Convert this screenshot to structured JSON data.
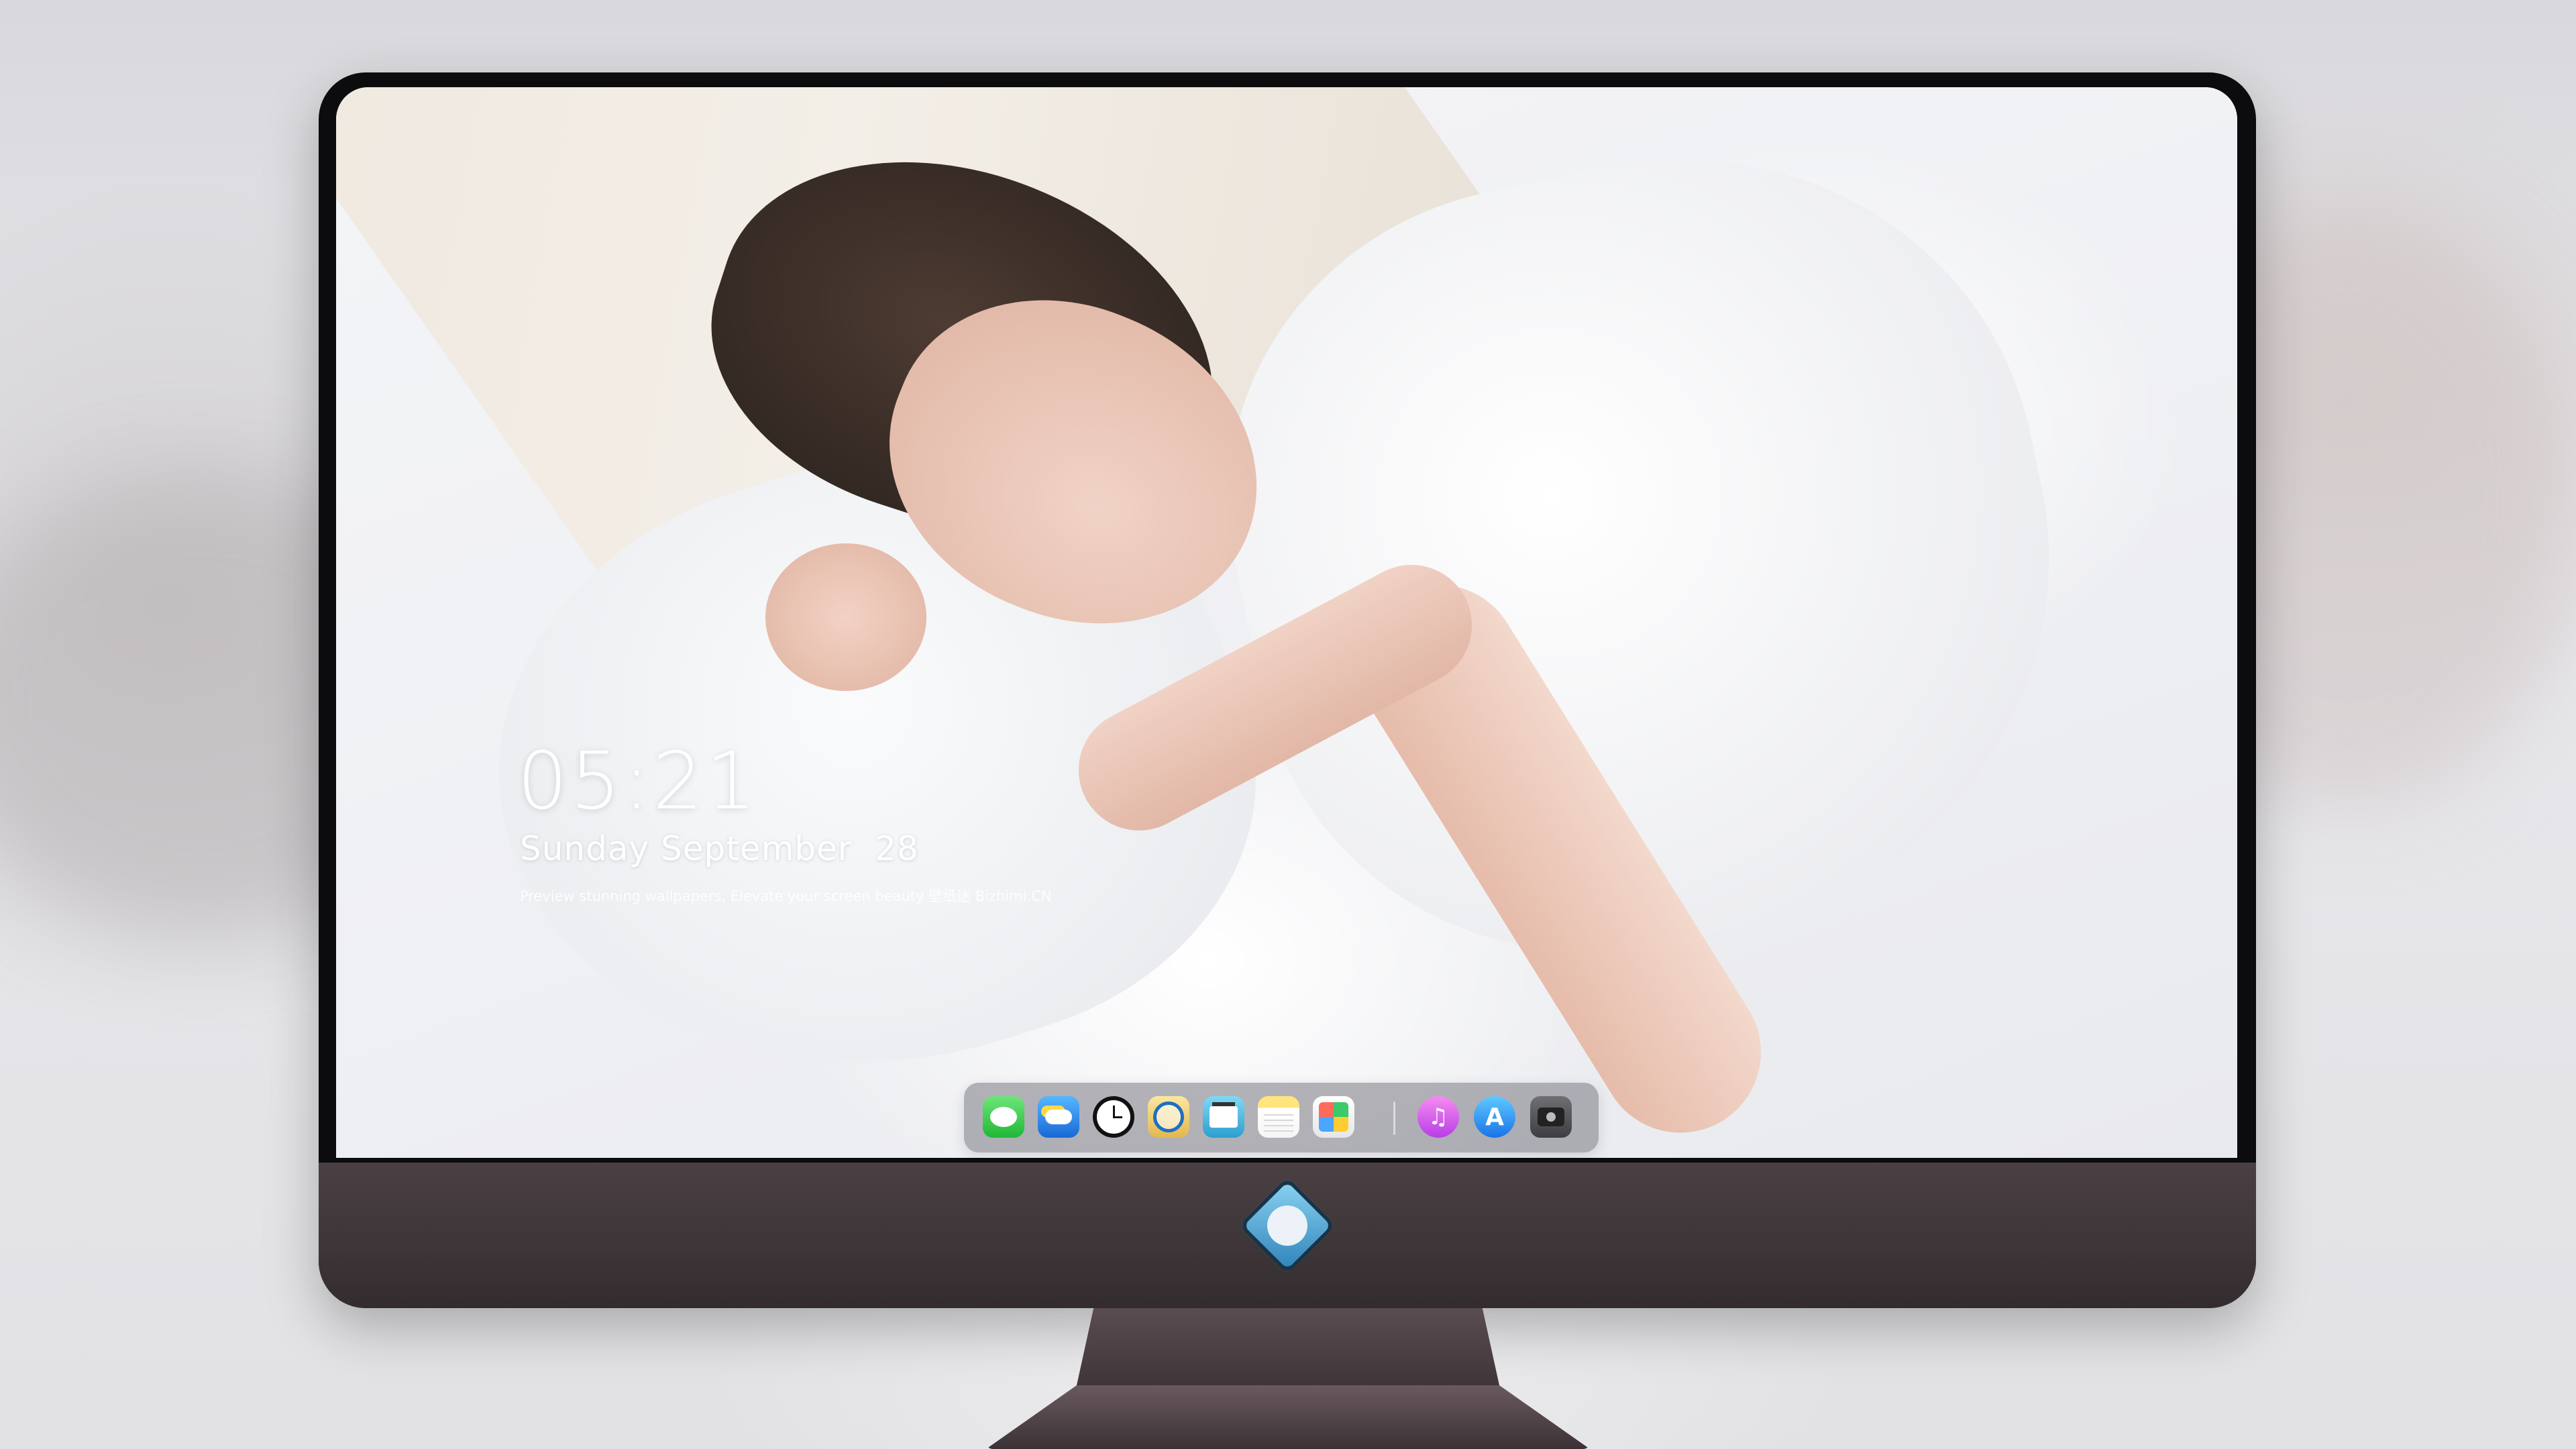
{
  "lockscreen": {
    "time": "05:21",
    "date": "Sunday September  28",
    "tagline": "Preview stunning wallpapers, Elevate your screen beauty  壁纸迷  Bizhimi.CN"
  },
  "dock": {
    "apps": [
      {
        "name": "Messages",
        "icon": "messages-icon"
      },
      {
        "name": "Weather",
        "icon": "weather-icon"
      },
      {
        "name": "Clock",
        "icon": "clock-icon"
      },
      {
        "name": "Preview",
        "icon": "preview-icon"
      },
      {
        "name": "Clips",
        "icon": "clapperboard-icon"
      },
      {
        "name": "Notes",
        "icon": "notes-icon"
      },
      {
        "name": "Photo Booth",
        "icon": "photos-icon"
      },
      {
        "name": "Music",
        "icon": "music-note-icon"
      },
      {
        "name": "App Store",
        "icon": "app-store-icon"
      },
      {
        "name": "Camera",
        "icon": "camera-icon"
      }
    ]
  },
  "colors": {
    "monitor_chin": "#3d3538",
    "bezel": "#0c0c0e",
    "dock_bg": "rgba(120,120,130,0.55)",
    "clock_text": "#ffffff"
  }
}
